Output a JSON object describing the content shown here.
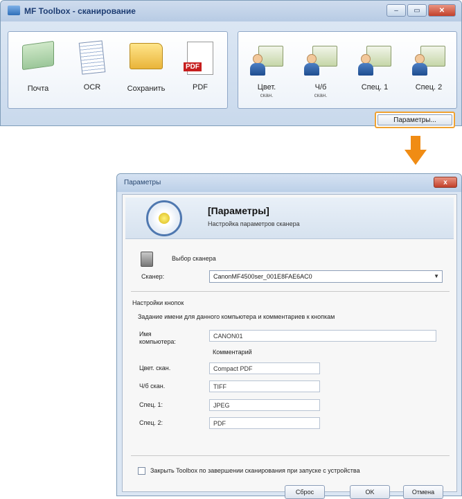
{
  "toolbox": {
    "title": "MF Toolbox - сканирование",
    "left_tools": [
      {
        "label": "Почта",
        "icon": "mail-icon"
      },
      {
        "label": "OCR",
        "icon": "ocr-document-icon"
      },
      {
        "label": "Сохранить",
        "icon": "folder-save-icon"
      },
      {
        "label": "PDF",
        "icon": "pdf-icon"
      }
    ],
    "right_tools": [
      {
        "label": "Цвет.",
        "sub": "скан.",
        "icon": "color-scan-icon"
      },
      {
        "label": "Ч/б",
        "sub": "скан.",
        "icon": "bw-scan-icon"
      },
      {
        "label": "Спец. 1",
        "sub": "",
        "icon": "custom1-scan-icon"
      },
      {
        "label": "Спец. 2",
        "sub": "",
        "icon": "custom2-scan-icon"
      }
    ],
    "params_button": "Параметры..."
  },
  "dialog": {
    "title": "Параметры",
    "close_label": "x",
    "header_title": "[Параметры]",
    "header_sub": "Настройка параметров сканера",
    "scanner_section": "Выбор сканера",
    "scanner_label": "Сканер:",
    "scanner_value": "CanonMF4500ser_001E8FAE6AC0",
    "button_settings_section": "Настройки кнопок",
    "button_settings_desc": "Задание имени для данного компьютера и комментариев к кнопкам",
    "computer_name_label": "Имя компьютера:",
    "computer_name_value": "CANON01",
    "comment_header": "Комментарий",
    "rows": [
      {
        "label": "Цвет. скан.",
        "value": "Compact PDF"
      },
      {
        "label": "Ч/б скан.",
        "value": "TIFF"
      },
      {
        "label": "Спец. 1:",
        "value": "JPEG"
      },
      {
        "label": "Спец. 2:",
        "value": "PDF"
      }
    ],
    "close_checkbox_label": "Закрыть Toolbox по завершении сканирования при запуске с устройства",
    "reset_button": "Сброс",
    "ok_button": "OK",
    "cancel_button": "Отмена"
  },
  "colors": {
    "accent": "#f08c14",
    "close": "#c2402a"
  }
}
